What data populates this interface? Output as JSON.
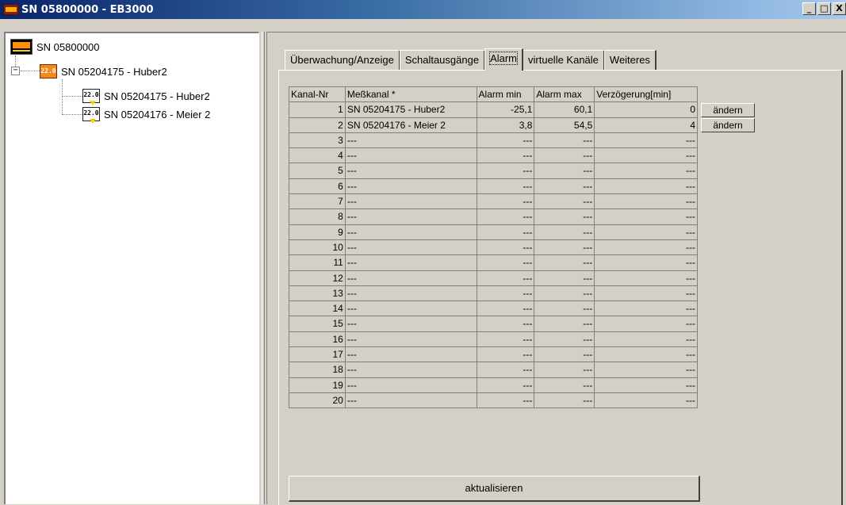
{
  "window": {
    "title": "SN 05800000 - EB3000",
    "controls": {
      "minimize": "_",
      "maximize": "□",
      "close": "X"
    }
  },
  "tree": {
    "root": {
      "label": "SN 05800000",
      "icon": "logger-device-icon"
    },
    "device": {
      "label": "SN 05204175 - Huber2",
      "expander": "−",
      "icon": "sensor-device-icon"
    },
    "channels": [
      {
        "label": "SN 05204175 - Huber2",
        "icon": "sensor-channel-icon"
      },
      {
        "label": "SN 05204176 - Meier 2",
        "icon": "sensor-channel-icon"
      }
    ]
  },
  "tabs": [
    {
      "label": "Überwachung/Anzeige",
      "active": false
    },
    {
      "label": "Schaltausgänge",
      "active": false
    },
    {
      "label": "Alarm",
      "active": true
    },
    {
      "label": "virtuelle Kanäle",
      "active": false
    },
    {
      "label": "Weiteres",
      "active": false
    }
  ],
  "grid": {
    "headers": [
      "Kanal-Nr",
      "Meßkanal *",
      "Alarm min",
      "Alarm max",
      "Verzögerung[min]"
    ],
    "rows": [
      [
        "1",
        "SN 05204175 - Huber2",
        "-25,1",
        "60,1",
        "0"
      ],
      [
        "2",
        "SN 05204176 - Meier 2",
        "3,8",
        "54,5",
        "4"
      ],
      [
        "3",
        "---",
        "---",
        "---",
        "---"
      ],
      [
        "4",
        "---",
        "---",
        "---",
        "---"
      ],
      [
        "5",
        "---",
        "---",
        "---",
        "---"
      ],
      [
        "6",
        "---",
        "---",
        "---",
        "---"
      ],
      [
        "7",
        "---",
        "---",
        "---",
        "---"
      ],
      [
        "8",
        "---",
        "---",
        "---",
        "---"
      ],
      [
        "9",
        "---",
        "---",
        "---",
        "---"
      ],
      [
        "10",
        "---",
        "---",
        "---",
        "---"
      ],
      [
        "11",
        "---",
        "---",
        "---",
        "---"
      ],
      [
        "12",
        "---",
        "---",
        "---",
        "---"
      ],
      [
        "13",
        "---",
        "---",
        "---",
        "---"
      ],
      [
        "14",
        "---",
        "---",
        "---",
        "---"
      ],
      [
        "15",
        "---",
        "---",
        "---",
        "---"
      ],
      [
        "16",
        "---",
        "---",
        "---",
        "---"
      ],
      [
        "17",
        "---",
        "---",
        "---",
        "---"
      ],
      [
        "18",
        "---",
        "---",
        "---",
        "---"
      ],
      [
        "19",
        "---",
        "---",
        "---",
        "---"
      ],
      [
        "20",
        "---",
        "---",
        "---",
        "---"
      ]
    ],
    "row_buttons": [
      "ändern",
      "ändern"
    ]
  },
  "refresh_button": "aktualisieren",
  "colors": {
    "titlebar_start": "#0a246a",
    "titlebar_end": "#a6caf0",
    "face": "#d4d0c8",
    "device_icon": "#f08a18"
  }
}
